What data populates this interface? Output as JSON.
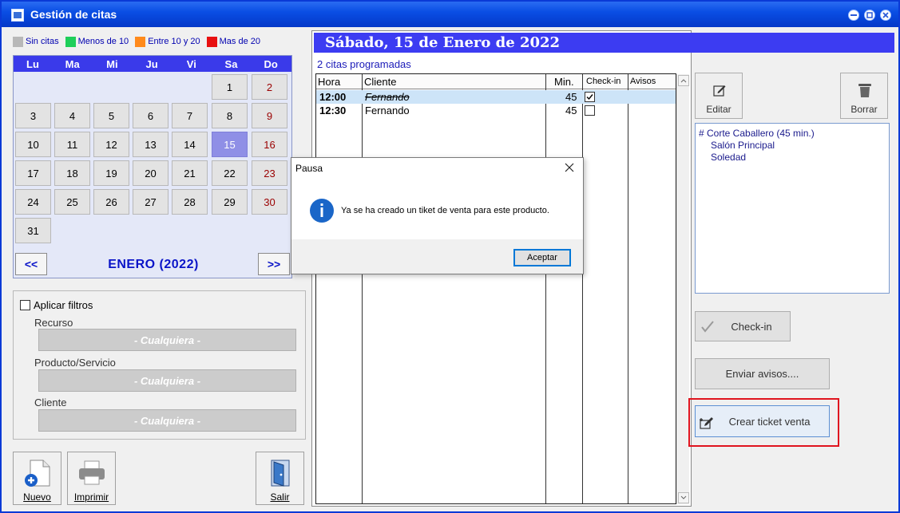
{
  "window": {
    "title": "Gestión de citas"
  },
  "legend": [
    {
      "label": "Sin citas",
      "color": "#b8b8b8"
    },
    {
      "label": "Menos de 10",
      "color": "#1fcf5a"
    },
    {
      "label": "Entre 10 y 20",
      "color": "#ff8a1c"
    },
    {
      "label": "Mas de 20",
      "color": "#e81010"
    }
  ],
  "calendar": {
    "weekdays": [
      "Lu",
      "Ma",
      "Mi",
      "Ju",
      "Vi",
      "Sa",
      "Do"
    ],
    "days": [
      "1",
      "2",
      "3",
      "4",
      "5",
      "6",
      "7",
      "8",
      "9",
      "10",
      "11",
      "12",
      "13",
      "14",
      "15",
      "16",
      "17",
      "18",
      "19",
      "20",
      "21",
      "22",
      "23",
      "24",
      "25",
      "26",
      "27",
      "28",
      "29",
      "30",
      "31"
    ],
    "selected_day": "15",
    "prev_label": "<<",
    "next_label": ">>",
    "month_label": "ENERO  (2022)"
  },
  "filters": {
    "apply_label": "Aplicar filtros",
    "resource_label": "Recurso",
    "resource_value": "- Cualquiera -",
    "product_label": "Producto/Servicio",
    "product_value": "- Cualquiera -",
    "client_label": "Cliente",
    "client_value": "- Cualquiera -"
  },
  "bottom_buttons": {
    "new": "Nuevo",
    "print": "Imprimir",
    "exit": "Salir"
  },
  "schedule": {
    "date_header": "Sábado, 15 de Enero de 2022",
    "count_label": "2 citas programadas",
    "columns": [
      "Hora",
      "Cliente",
      "Min.",
      "Check-in",
      "Avisos"
    ],
    "rows": [
      {
        "time": "12:00",
        "client": "Fernando",
        "minutes": "45",
        "checked": true,
        "cancelled": true
      },
      {
        "time": "12:30",
        "client": "Fernando",
        "minutes": "45",
        "checked": false,
        "cancelled": false
      }
    ]
  },
  "actions": {
    "edit": "Editar",
    "delete": "Borrar",
    "checkin": "Check-in",
    "send_alerts": "Enviar avisos....",
    "create_ticket": "Crear ticket venta"
  },
  "detail": {
    "service": "# Corte Caballero  (45 min.)",
    "location": "Salón Principal",
    "staff": "Soledad"
  },
  "dialog": {
    "title": "Pausa",
    "message": "Ya se ha creado un tiket de venta para este producto.",
    "ok": "Aceptar"
  }
}
